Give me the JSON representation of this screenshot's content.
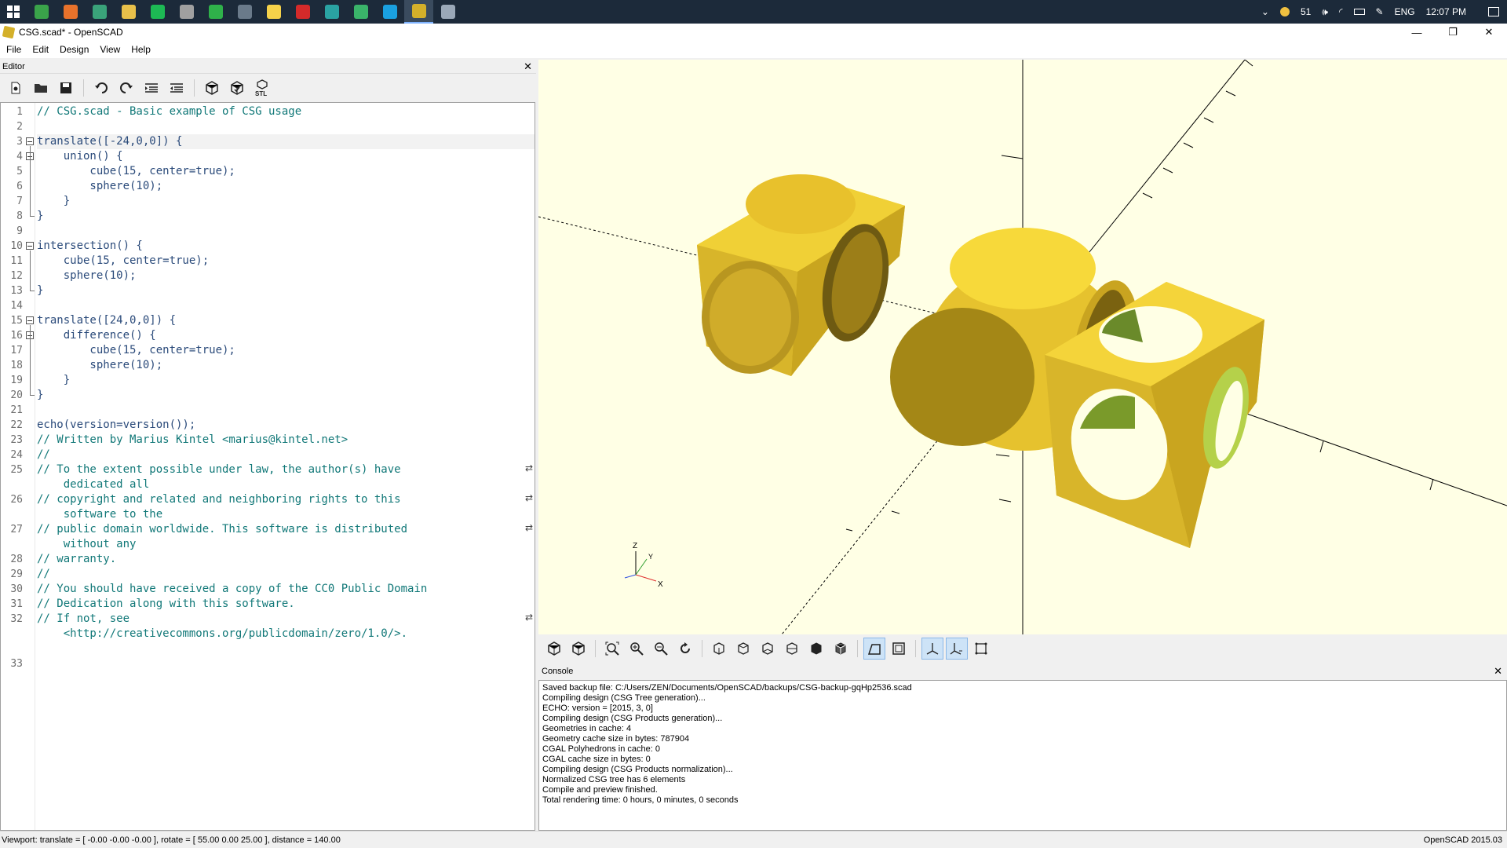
{
  "taskbar": {
    "apps": [
      {
        "name": "terminal-app",
        "color": "#3aa34a"
      },
      {
        "name": "firefox-app",
        "color": "#e8722b"
      },
      {
        "name": "green-circle-app",
        "color": "#3aa37a"
      },
      {
        "name": "file-explorer-app",
        "color": "#e8c04a"
      },
      {
        "name": "spotify-app",
        "color": "#1db954"
      },
      {
        "name": "git-app",
        "color": "#a0a0a0"
      },
      {
        "name": "green-arrow-app",
        "color": "#2fb14a"
      },
      {
        "name": "media-app",
        "color": "#6a7a8a"
      },
      {
        "name": "sticky-notes-app",
        "color": "#f5d24a"
      },
      {
        "name": "acrobat-app",
        "color": "#d42a2a"
      },
      {
        "name": "arduino-app",
        "color": "#2aa3a3"
      },
      {
        "name": "green-globe-app",
        "color": "#3ab36a"
      },
      {
        "name": "skype-app",
        "color": "#1aa0e0"
      },
      {
        "name": "openscad-app",
        "color": "#d4b02a"
      },
      {
        "name": "disk-app",
        "color": "#9aa8b8"
      }
    ],
    "tray": {
      "temperature": "51",
      "language": "ENG",
      "clock": "12:07 PM"
    }
  },
  "window": {
    "title": "CSG.scad* - OpenSCAD",
    "minimize": "—",
    "maximize": "❐",
    "close": "✕"
  },
  "menu": [
    "File",
    "Edit",
    "Design",
    "View",
    "Help"
  ],
  "editor": {
    "title": "Editor",
    "close": "✕",
    "lines": [
      {
        "n": "1",
        "text": "// CSG.scad - Basic example of CSG usage",
        "type": "comment"
      },
      {
        "n": "2",
        "text": "",
        "type": "code"
      },
      {
        "n": "3",
        "text": "translate([-24,0,0]) {",
        "type": "code"
      },
      {
        "n": "4",
        "text": "    union() {",
        "type": "code"
      },
      {
        "n": "5",
        "text": "        cube(15, center=true);",
        "type": "code"
      },
      {
        "n": "6",
        "text": "        sphere(10);",
        "type": "code"
      },
      {
        "n": "7",
        "text": "    }",
        "type": "code"
      },
      {
        "n": "8",
        "text": "}",
        "type": "code"
      },
      {
        "n": "9",
        "text": "",
        "type": "code"
      },
      {
        "n": "10",
        "text": "intersection() {",
        "type": "code"
      },
      {
        "n": "11",
        "text": "    cube(15, center=true);",
        "type": "code"
      },
      {
        "n": "12",
        "text": "    sphere(10);",
        "type": "code"
      },
      {
        "n": "13",
        "text": "}",
        "type": "code"
      },
      {
        "n": "14",
        "text": "",
        "type": "code"
      },
      {
        "n": "15",
        "text": "translate([24,0,0]) {",
        "type": "code"
      },
      {
        "n": "16",
        "text": "    difference() {",
        "type": "code"
      },
      {
        "n": "17",
        "text": "        cube(15, center=true);",
        "type": "code"
      },
      {
        "n": "18",
        "text": "        sphere(10);",
        "type": "code"
      },
      {
        "n": "19",
        "text": "    }",
        "type": "code"
      },
      {
        "n": "20",
        "text": "}",
        "type": "code"
      },
      {
        "n": "21",
        "text": "",
        "type": "code"
      },
      {
        "n": "22",
        "text": "echo(version=version());",
        "type": "code"
      },
      {
        "n": "23",
        "text": "// Written by Marius Kintel <marius@kintel.net>",
        "type": "comment"
      },
      {
        "n": "24",
        "text": "//",
        "type": "comment"
      },
      {
        "n": "25",
        "text": "// To the extent possible under law, the author(s) have",
        "type": "comment"
      },
      {
        "n": "",
        "text": "    dedicated all",
        "type": "cont"
      },
      {
        "n": "26",
        "text": "// copyright and related and neighboring rights to this",
        "type": "comment"
      },
      {
        "n": "",
        "text": "    software to the",
        "type": "cont"
      },
      {
        "n": "27",
        "text": "// public domain worldwide. This software is distributed",
        "type": "comment"
      },
      {
        "n": "",
        "text": "    without any",
        "type": "cont"
      },
      {
        "n": "28",
        "text": "// warranty.",
        "type": "comment"
      },
      {
        "n": "29",
        "text": "//",
        "type": "comment"
      },
      {
        "n": "30",
        "text": "// You should have received a copy of the CC0 Public Domain",
        "type": "comment"
      },
      {
        "n": "31",
        "text": "// Dedication along with this software.",
        "type": "comment"
      },
      {
        "n": "32",
        "text": "// If not, see",
        "type": "comment"
      },
      {
        "n": "",
        "text": "    <http://creativecommons.org/publicdomain/zero/1.0/>.",
        "type": "cont"
      },
      {
        "n": "",
        "text": "",
        "type": "code"
      },
      {
        "n": "33",
        "text": "",
        "type": "code"
      }
    ]
  },
  "toolbar": {
    "stl_label": "STL"
  },
  "axes_indicator": {
    "z": "Z",
    "y": "Y",
    "x": "X"
  },
  "console": {
    "title": "Console",
    "close": "✕",
    "lines": [
      "Saved backup file: C:/Users/ZEN/Documents/OpenSCAD/backups/CSG-backup-gqHp2536.scad",
      "Compiling design (CSG Tree generation)...",
      "ECHO: version = [2015, 3, 0]",
      "Compiling design (CSG Products generation)...",
      "Geometries in cache: 4",
      "Geometry cache size in bytes: 787904",
      "CGAL Polyhedrons in cache: 0",
      "CGAL cache size in bytes: 0",
      "Compiling design (CSG Products normalization)...",
      "Normalized CSG tree has 6 elements",
      "Compile and preview finished.",
      "Total rendering time: 0 hours, 0 minutes, 0 seconds"
    ]
  },
  "status": {
    "viewport": "Viewport: translate = [ -0.00 -0.00 -0.00 ], rotate = [ 55.00 0.00 25.00 ], distance = 140.00",
    "version": "OpenSCAD 2015.03"
  }
}
